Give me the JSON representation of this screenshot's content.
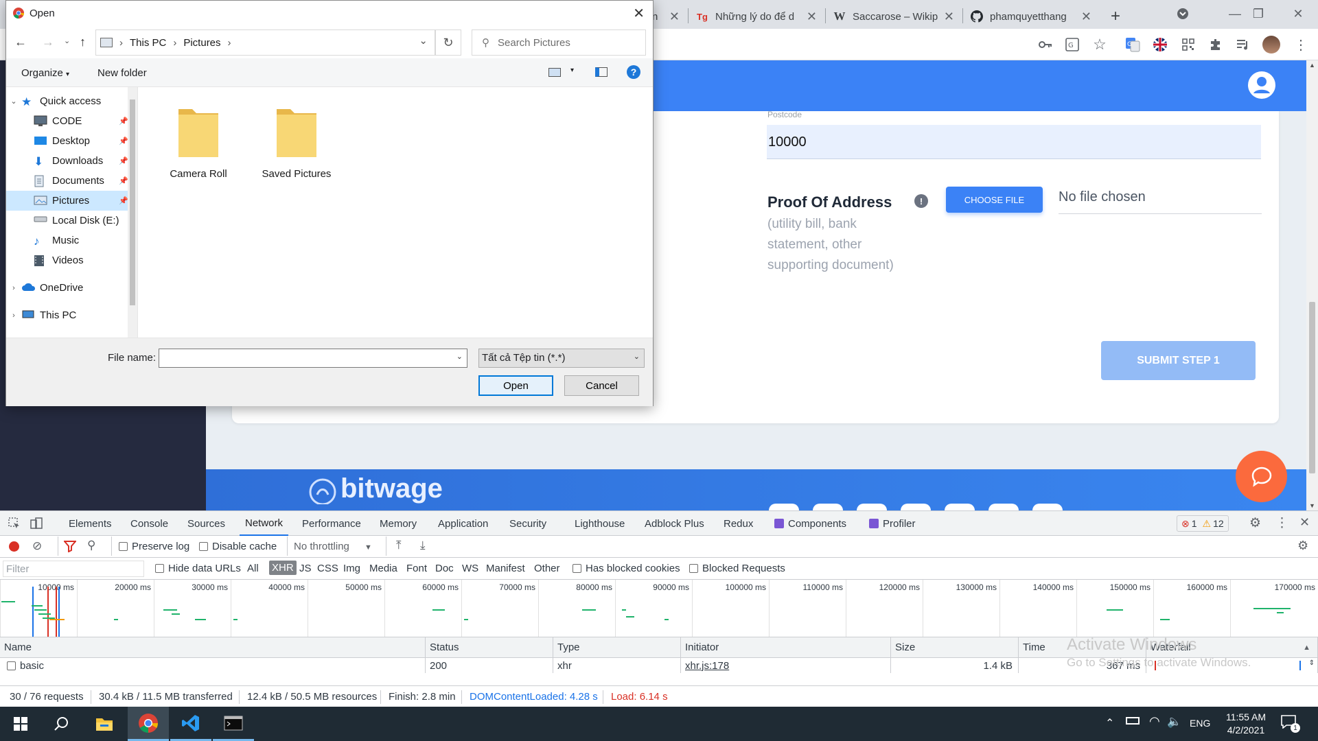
{
  "browser": {
    "tabs": [
      {
        "title": "n",
        "icon": "unknown-favicon"
      },
      {
        "title": "Những lý do để d",
        "icon": "tg-favicon"
      },
      {
        "title": "Saccarose – Wikip",
        "icon": "wikipedia-favicon"
      },
      {
        "title": "phamquyetthang",
        "icon": "github-favicon"
      }
    ],
    "new_tab": "+"
  },
  "page": {
    "postcode_label": "Postcode",
    "postcode_value": "10000",
    "proof_title": "Proof Of Address",
    "proof_desc": "(utility bill, bank statement, other supporting document)",
    "info_icon": "!",
    "choose_file": "CHOOSE FILE",
    "no_file": "No file chosen",
    "submit": "SUBMIT STEP 1",
    "footer_logo": "bitwage",
    "colors": {
      "primary": "#3b82f6",
      "submit_disabled": "#93bbf6",
      "chat": "#fb6a3d",
      "sidebar": "#252a3f"
    }
  },
  "dialog": {
    "title": "Open",
    "breadcrumb": [
      "This PC",
      "Pictures"
    ],
    "search_placeholder": "Search Pictures",
    "organize": "Organize",
    "new_folder": "New folder",
    "help": "?",
    "nav": [
      {
        "label": "Quick access",
        "icon": "star-icon"
      },
      {
        "label": "CODE",
        "icon": "computer-icon",
        "pinned": true
      },
      {
        "label": "Desktop",
        "icon": "desktop-icon",
        "pinned": true
      },
      {
        "label": "Downloads",
        "icon": "download-icon",
        "pinned": true
      },
      {
        "label": "Documents",
        "icon": "documents-icon",
        "pinned": true
      },
      {
        "label": "Pictures",
        "icon": "pictures-icon",
        "pinned": true
      },
      {
        "label": "Local Disk (E:)",
        "icon": "disk-icon"
      },
      {
        "label": "Music",
        "icon": "music-icon"
      },
      {
        "label": "Videos",
        "icon": "videos-icon"
      },
      {
        "label": "OneDrive",
        "icon": "cloud-icon"
      },
      {
        "label": "This PC",
        "icon": "pc-icon"
      }
    ],
    "folders": [
      "Camera Roll",
      "Saved Pictures"
    ],
    "file_name_label": "File name:",
    "file_name_value": "",
    "filter": "Tất cả Tệp tin (*.*)",
    "open": "Open",
    "cancel": "Cancel"
  },
  "devtools": {
    "tabs": [
      "Elements",
      "Console",
      "Sources",
      "Network",
      "Performance",
      "Memory",
      "Application",
      "Security",
      "Lighthouse",
      "Adblock Plus",
      "Redux",
      "Components",
      "Profiler"
    ],
    "active_tab": "Network",
    "errors": "1",
    "warnings": "12",
    "preserve_log": "Preserve log",
    "disable_cache": "Disable cache",
    "throttling": "No throttling",
    "filter_placeholder": "Filter",
    "hide_data_urls": "Hide data URLs",
    "types": [
      "All",
      "XHR",
      "JS",
      "CSS",
      "Img",
      "Media",
      "Font",
      "Doc",
      "WS",
      "Manifest",
      "Other"
    ],
    "active_type": "XHR",
    "has_blocked_cookies": "Has blocked cookies",
    "blocked_requests": "Blocked Requests",
    "timeline_ticks": [
      "10000 ms",
      "20000 ms",
      "30000 ms",
      "40000 ms",
      "50000 ms",
      "60000 ms",
      "70000 ms",
      "80000 ms",
      "90000 ms",
      "100000 ms",
      "110000 ms",
      "120000 ms",
      "130000 ms",
      "140000 ms",
      "150000 ms",
      "160000 ms",
      "170000 ms"
    ],
    "columns": [
      "Name",
      "Status",
      "Type",
      "Initiator",
      "Size",
      "Time",
      "Waterfall"
    ],
    "row": {
      "name": "basic",
      "status": "200",
      "type": "xhr",
      "initiator": "xhr.js:178",
      "size": "1.4 kB",
      "time": "367 ms"
    },
    "status": {
      "requests": "30 / 76 requests",
      "transferred": "30.4 kB / 11.5 MB transferred",
      "resources": "12.4 kB / 50.5 MB resources",
      "finish": "Finish: 2.8 min",
      "dcl": "DOMContentLoaded: 4.28 s",
      "load": "Load: 6.14 s"
    },
    "activate_title": "Activate Windows",
    "activate_sub": "Go to Settings to activate Windows."
  },
  "taskbar": {
    "lang": "ENG",
    "time": "11:55 AM",
    "date": "4/2/2021",
    "notifications": "1"
  }
}
